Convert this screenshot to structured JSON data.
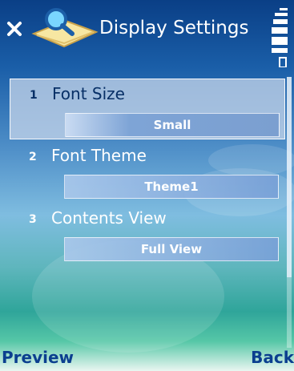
{
  "header": {
    "title": "Display Settings"
  },
  "settings": [
    {
      "number": "1",
      "label": "Font Size",
      "value": "Small",
      "selected": true
    },
    {
      "number": "2",
      "label": "Font Theme",
      "value": "Theme1",
      "selected": false
    },
    {
      "number": "3",
      "label": "Contents View",
      "value": "Full View",
      "selected": false
    }
  ],
  "softkeys": {
    "left": "Preview",
    "right": "Back"
  },
  "colors": {
    "accent": "#0b3f8f",
    "background_top": "#0a3f86",
    "background_bottom": "#56c7a7"
  }
}
